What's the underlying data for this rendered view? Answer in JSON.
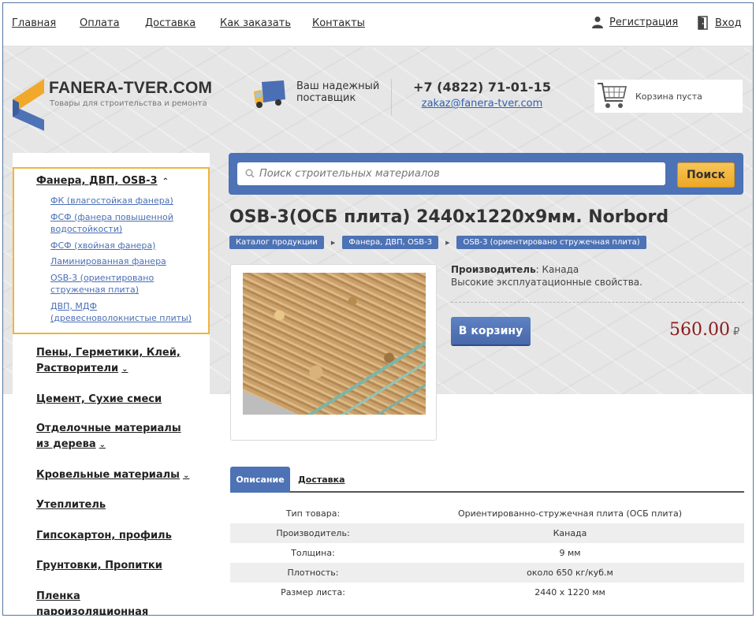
{
  "topnav": {
    "links": [
      "Главная",
      "Оплата",
      "Доставка",
      "Как заказать",
      "Контакты"
    ],
    "register": "Регистрация",
    "login": "Вход"
  },
  "logo": {
    "title": "FANERA-TVER.COM",
    "subtitle": "Товары для строительства и ремонта"
  },
  "supplier": {
    "text": "Ваш надежный поставщик"
  },
  "contacts": {
    "phone": "+7 (4822) 71-01-15",
    "email": "zakaz@fanera-tver.com"
  },
  "cart": {
    "status": "Корзина пуста"
  },
  "sidebar": {
    "open_category": "Фанера, ДВП, OSB-3",
    "subcategories": [
      "ФК (влагостойкая фанера)",
      "ФСФ (фанера повышенной водостойкости)",
      "ФСФ (хвойная фанера)",
      "Ламинированная фанера",
      "OSB-3 (ориентировано стружечная плита)",
      "ДВП, МДФ (древесноволокнистые плиты)"
    ],
    "categories": [
      "Пены, Герметики, Клей, Растворители",
      "Цемент, Сухие смеси",
      "Отделочные материалы из дерева",
      "Кровельные материалы",
      "Утеплитель",
      "Гипсокартон, профиль",
      "Грунтовки, Пропитки",
      "Пленка пароизоляционная"
    ]
  },
  "search": {
    "placeholder": "Поиск строительных материалов",
    "button": "Поиск"
  },
  "product": {
    "title": "OSB-3(ОСБ плита) 2440x1220x9мм. Norbord",
    "breadcrumbs": [
      "Каталог продукции",
      "Фанера, ДВП, OSB-3",
      "OSB-3 (ориентировано стружечная плита)"
    ],
    "manufacturer_label": "Производитель",
    "manufacturer_value": ": Канада",
    "feature": "Высокие эксплуатационные свойства.",
    "cart_button": "В корзину",
    "price": "560.00",
    "currency": "₽"
  },
  "tabs": {
    "description": "Описание",
    "delivery": "Доставка"
  },
  "specs": [
    {
      "key": "Тип товара:",
      "value": "Ориентированно-стружечная плита (ОСБ плита)"
    },
    {
      "key": "Производитель:",
      "value": "Канада"
    },
    {
      "key": "Толщина:",
      "value": "9 мм"
    },
    {
      "key": "Плотность:",
      "value": "около 650 кг/куб.м"
    },
    {
      "key": "Размер листа:",
      "value": "2440 x 1220 мм"
    }
  ],
  "colors": {
    "accent": "#4d72b5",
    "button_orange": "#eca826",
    "price": "#8b1a1a",
    "highlight": "#f0b43a"
  }
}
